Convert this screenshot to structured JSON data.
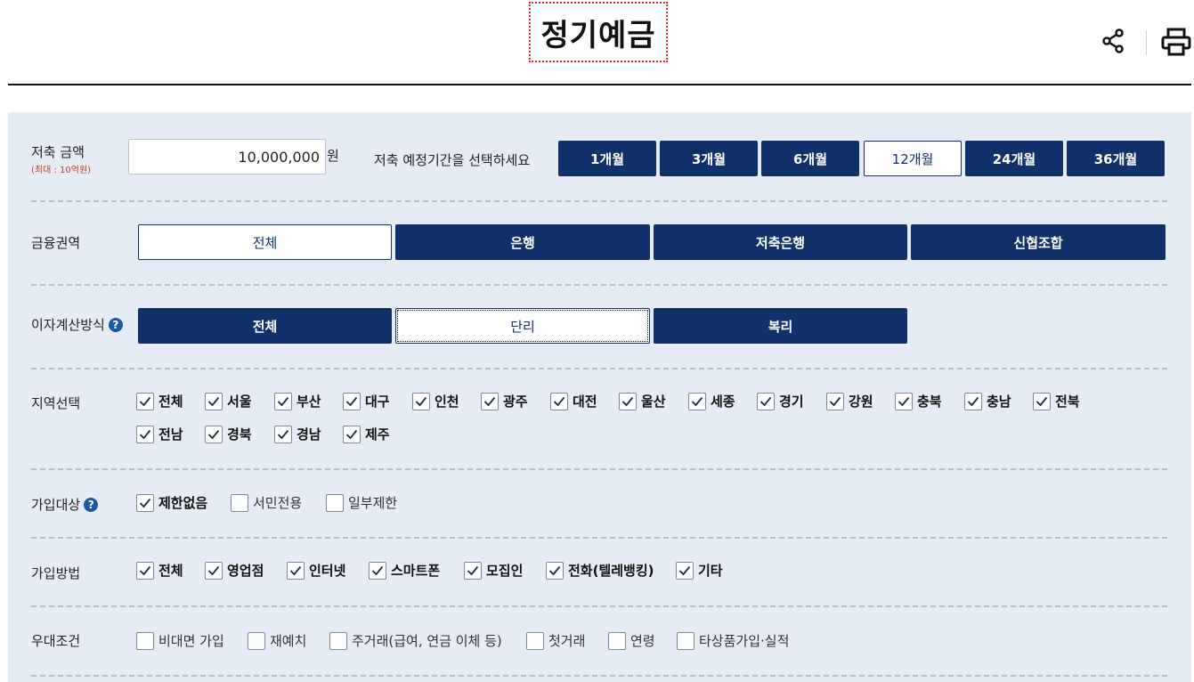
{
  "page": {
    "title": "정기예금"
  },
  "header": {
    "share_icon": "share-icon",
    "print_icon": "print-icon"
  },
  "amount": {
    "label": "저축 금액",
    "sublabel": "(최대 : 10억원)",
    "value": "10,000,000",
    "unit": "원"
  },
  "period": {
    "label": "저축 예정기간을 선택하세요",
    "options": [
      "1개월",
      "3개월",
      "6개월",
      "12개월",
      "24개월",
      "36개월"
    ],
    "selected": "12개월"
  },
  "sector": {
    "label": "금융권역",
    "options": [
      "전체",
      "은행",
      "저축은행",
      "신협조합"
    ],
    "selected": "전체"
  },
  "interest": {
    "label": "이자계산방식",
    "help_icon": "question-icon",
    "options": [
      "전체",
      "단리",
      "복리"
    ],
    "selected": "단리"
  },
  "region": {
    "label": "지역선택",
    "items": [
      {
        "label": "전체",
        "checked": true
      },
      {
        "label": "서울",
        "checked": true
      },
      {
        "label": "부산",
        "checked": true
      },
      {
        "label": "대구",
        "checked": true
      },
      {
        "label": "인천",
        "checked": true
      },
      {
        "label": "광주",
        "checked": true
      },
      {
        "label": "대전",
        "checked": true
      },
      {
        "label": "울산",
        "checked": true
      },
      {
        "label": "세종",
        "checked": true
      },
      {
        "label": "경기",
        "checked": true
      },
      {
        "label": "강원",
        "checked": true
      },
      {
        "label": "충북",
        "checked": true
      },
      {
        "label": "충남",
        "checked": true
      },
      {
        "label": "전북",
        "checked": true
      },
      {
        "label": "전남",
        "checked": true
      },
      {
        "label": "경북",
        "checked": true
      },
      {
        "label": "경남",
        "checked": true
      },
      {
        "label": "제주",
        "checked": true
      }
    ]
  },
  "target": {
    "label": "가입대상",
    "help_icon": "question-icon",
    "items": [
      {
        "label": "제한없음",
        "checked": true
      },
      {
        "label": "서민전용",
        "checked": false
      },
      {
        "label": "일부제한",
        "checked": false
      }
    ]
  },
  "method": {
    "label": "가입방법",
    "items": [
      {
        "label": "전체",
        "checked": true
      },
      {
        "label": "영업점",
        "checked": true
      },
      {
        "label": "인터넷",
        "checked": true
      },
      {
        "label": "스마트폰",
        "checked": true
      },
      {
        "label": "모집인",
        "checked": true
      },
      {
        "label": "전화(텔레뱅킹)",
        "checked": true
      },
      {
        "label": "기타",
        "checked": true
      }
    ]
  },
  "benefit": {
    "label": "우대조건",
    "items": [
      {
        "label": "비대면 가입",
        "checked": false
      },
      {
        "label": "재예치",
        "checked": false
      },
      {
        "label": "주거래(급여, 연금 이체 등)",
        "checked": false
      },
      {
        "label": "첫거래",
        "checked": false
      },
      {
        "label": "연령",
        "checked": false
      },
      {
        "label": "타상품가입·실적",
        "checked": false
      }
    ]
  }
}
